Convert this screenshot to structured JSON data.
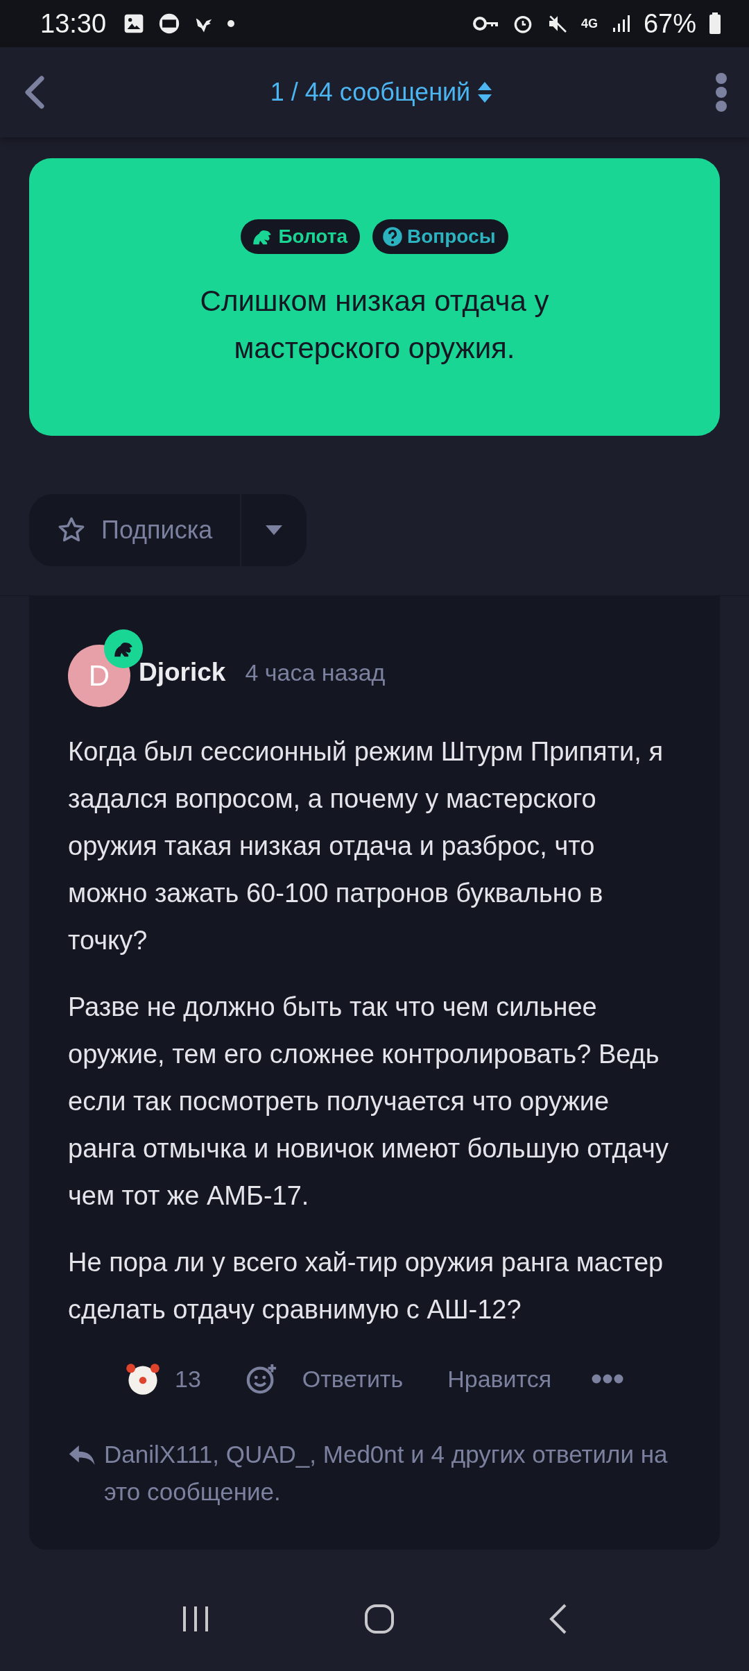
{
  "status_bar": {
    "time": "13:30",
    "network": "4G",
    "battery": "67%"
  },
  "header": {
    "counter": "1 / 44 сообщений"
  },
  "topic": {
    "tags": [
      {
        "label": "Болота",
        "kind": "frog",
        "color": "#19d695"
      },
      {
        "label": "Вопросы",
        "kind": "question",
        "color": "#2bb3c0"
      }
    ],
    "title": "Слишком низкая отдача у мастерского оружия."
  },
  "subscribe": {
    "label": "Подписка"
  },
  "post": {
    "author": {
      "initial": "D",
      "name": "Djorick",
      "time": "4 часа назад"
    },
    "paragraphs": [
      "Когда был сессионный режим Штурм Припяти, я задался вопросом, а почему у мастерского оружия такая низкая отдача и разброс, что можно зажать 60-100 патронов буквально в точку?",
      "Разве не должно быть так что чем сильнее оружие, тем его сложнее контролировать? Ведь если так посмотреть получается что оружие ранга отмычка и новичок имеют большую отдачу чем тот же АМБ-17.",
      "Не пора ли у всего хай-тир оружия ранга мастер сделать отдачу сравнимую с АШ-12?"
    ],
    "reaction": {
      "count": "13"
    },
    "actions": [
      "Ответить",
      "Нравится"
    ],
    "replies": "DanilX111, QUAD_, Med0nt и 4 других ответили на это сообщение."
  }
}
